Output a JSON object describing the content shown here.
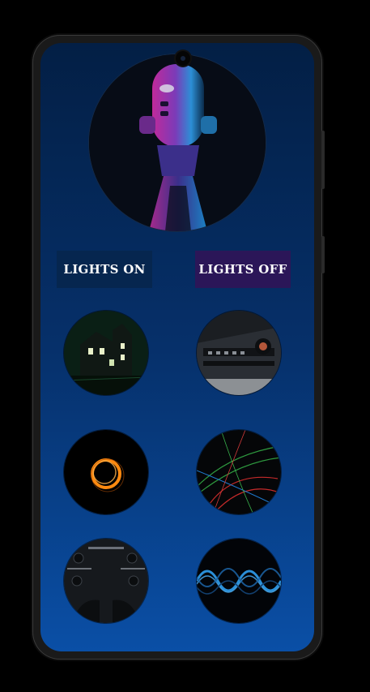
{
  "controls": {
    "lights_on_label": "LIGHTS ON",
    "lights_off_label": "LIGHTS OFF"
  },
  "hero": {
    "icon": "microphone-image"
  },
  "thumbnails": [
    {
      "icon": "haunted-house-image"
    },
    {
      "icon": "audio-equipment-image"
    },
    {
      "icon": "orange-ring-image"
    },
    {
      "icon": "colorful-particles-image"
    },
    {
      "icon": "control-panel-image"
    },
    {
      "icon": "blue-waves-image"
    }
  ],
  "colors": {
    "screen_top": "#031f45",
    "screen_bottom": "#0a4fa6",
    "lights_on_bg": "#06264f",
    "lights_off_bg": "#2b1658"
  }
}
